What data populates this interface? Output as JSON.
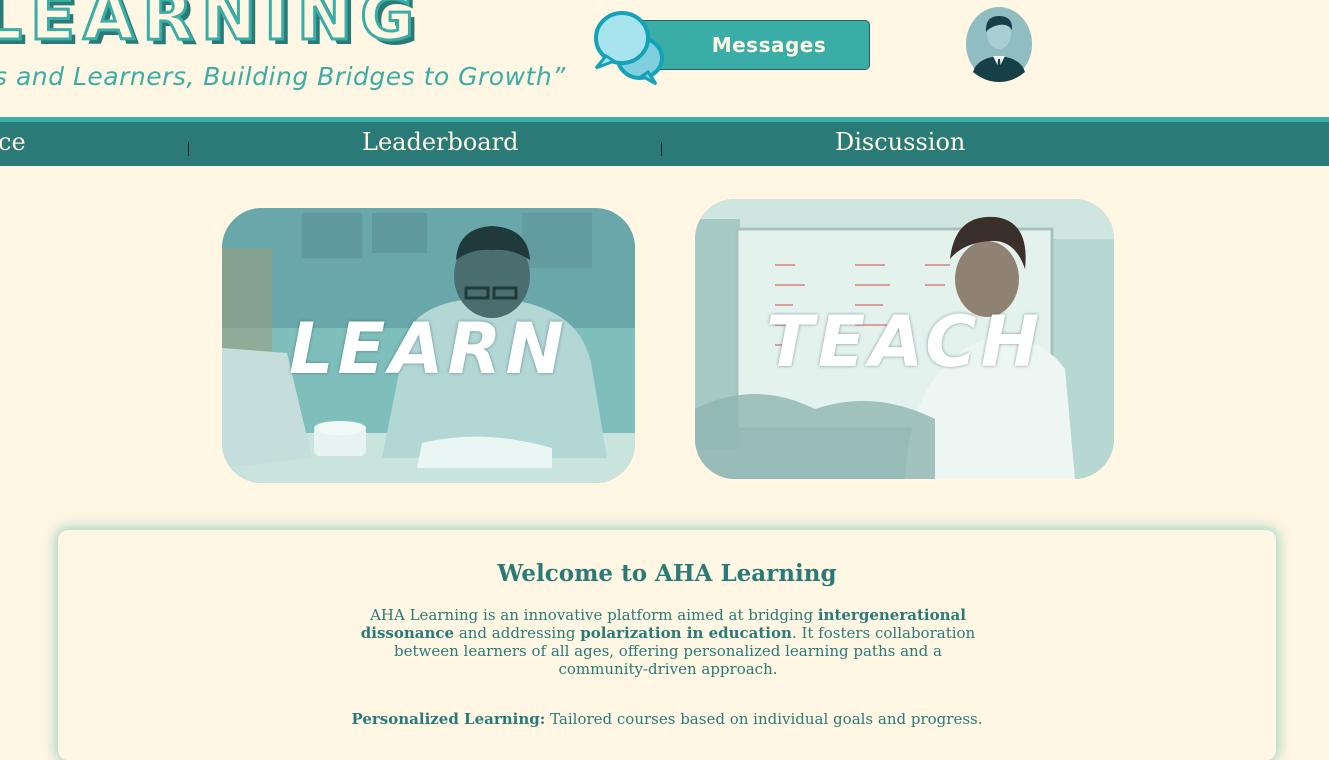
{
  "header": {
    "brand": "LEARNING",
    "tagline": "s and Learners, Building Bridges to Growth”",
    "messages_label": "Messages",
    "chat_icon": "chat-bubbles-icon",
    "avatar_icon": "user-avatar-icon"
  },
  "nav": {
    "items": [
      {
        "label": "ce"
      },
      {
        "label": "Leaderboard"
      },
      {
        "label": "Discussion"
      }
    ]
  },
  "cards": {
    "learn": {
      "label": "LEARN"
    },
    "teach": {
      "label": "TEACH"
    }
  },
  "welcome": {
    "title": "Welcome to AHA Learning",
    "intro_1": "AHA Learning is an innovative platform aimed at bridging ",
    "intro_b1": "intergenerational dissonance",
    "intro_2": " and addressing ",
    "intro_b2": "polarization in education",
    "intro_3": ". It fosters collaboration between learners of all ages, offering personalized learning paths and a community-driven approach.",
    "feature_title": "Personalized Learning:",
    "feature_text": " Tailored courses based on individual goals and progress."
  },
  "colors": {
    "background": "#fff6e3",
    "accent": "#3aaea6",
    "nav": "#2a7a78"
  }
}
